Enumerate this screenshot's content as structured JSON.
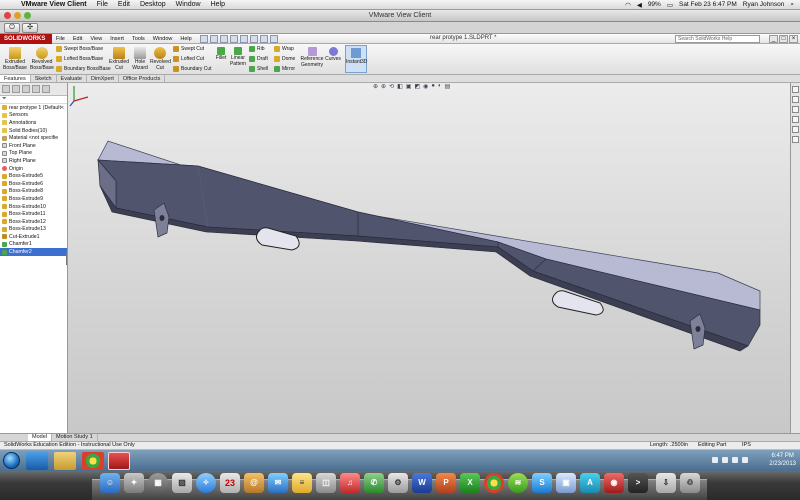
{
  "mac_menubar": {
    "apple_glyph": "",
    "app": "VMware View Client",
    "menus": [
      "File",
      "Edit",
      "Desktop",
      "Window",
      "Help"
    ],
    "battery": "99%",
    "datetime": "Sat Feb 23  6:47 PM",
    "user": "Ryan Johnson"
  },
  "vmware": {
    "window_title": "VMware View Client"
  },
  "solidworks": {
    "logo": "SOLIDWORKS",
    "menus": [
      "File",
      "Edit",
      "View",
      "Insert",
      "Tools",
      "Window",
      "Help"
    ],
    "document_title": "rear protype 1.SLDPRT *",
    "search_placeholder": "Search SolidWorks Help",
    "toolbar": {
      "extruded_boss": "Extruded Boss/Base",
      "revolved_boss": "Revolved Boss/Base",
      "swept_boss": "Swept Boss/Base",
      "lofted_boss": "Lofted Boss/Base",
      "boundary_boss": "Boundary Boss/Base",
      "extruded_cut": "Extruded Cut",
      "hole_wizard": "Hole Wizard",
      "revolved_cut": "Revolved Cut",
      "swept_cut": "Swept Cut",
      "lofted_cut": "Lofted Cut",
      "boundary_cut": "Boundary Cut",
      "fillet": "Fillet",
      "linear_pattern": "Linear Pattern",
      "rib": "Rib",
      "draft": "Draft",
      "shell": "Shell",
      "wrap": "Wrap",
      "dome": "Dome",
      "mirror": "Mirror",
      "reference_geometry": "Reference Geometry",
      "curves": "Curves",
      "instant3d": "Instant3D"
    },
    "tabs": [
      "Features",
      "Sketch",
      "Evaluate",
      "DimXpert",
      "Office Products"
    ],
    "tree": {
      "root": "rear protype 1  (Default<",
      "items": [
        "Sensors",
        "Annotations",
        "Solid Bodies(10)",
        "Material <not specifie",
        "Front Plane",
        "Top Plane",
        "Right Plane",
        "Origin",
        "Boss-Extrude5",
        "Boss-Extrude6",
        "Boss-Extrude8",
        "Boss-Extrude9",
        "Boss-Extrude10",
        "Boss-Extrude11",
        "Boss-Extrude12",
        "Boss-Extrude13",
        "Cut-Extrude1",
        "Chamfer1",
        "Chamfer2"
      ]
    },
    "bottom_tabs": [
      "Model",
      "Motion Study 1"
    ],
    "status": {
      "edition": "SolidWorks Education Edition - Instructional Use Only",
      "length": "Length: .2500in",
      "mode": "Editing Part",
      "units": "IPS"
    }
  },
  "windows_taskbar": {
    "time": "6:47 PM",
    "date": "2/23/2013"
  },
  "dock": {
    "calendar_day": "23"
  }
}
